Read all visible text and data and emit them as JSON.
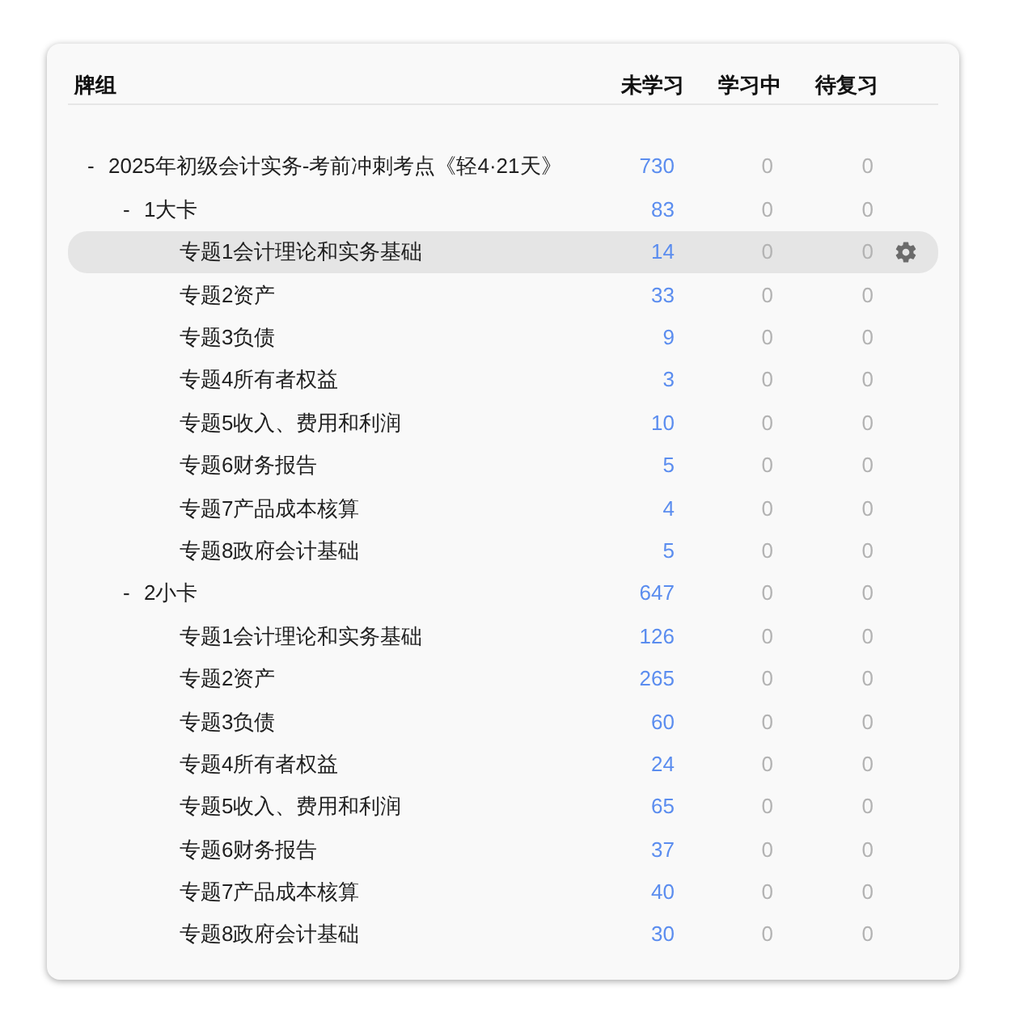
{
  "columns": [
    "牌组",
    "未学习",
    "学习中",
    "待复习"
  ],
  "decks": [
    {
      "toggle": "-",
      "name": "2025年初级会计实务-考前冲刺考点《轻4·21天》",
      "new": "730",
      "learn": "0",
      "review": "0",
      "selected": false,
      "children": [
        {
          "toggle": "-",
          "name": "1大卡",
          "new": "83",
          "learn": "0",
          "review": "0",
          "selected": false,
          "children": [
            {
              "name": "专题1会计理论和实务基础",
              "new": "14",
              "learn": "0",
              "review": "0",
              "selected": true
            },
            {
              "name": "专题2资产",
              "new": "33",
              "learn": "0",
              "review": "0",
              "selected": false
            },
            {
              "name": "专题3负债",
              "new": "9",
              "learn": "0",
              "review": "0",
              "selected": false
            },
            {
              "name": "专题4所有者权益",
              "new": "3",
              "learn": "0",
              "review": "0",
              "selected": false
            },
            {
              "name": "专题5收入、费用和利润",
              "new": "10",
              "learn": "0",
              "review": "0",
              "selected": false
            },
            {
              "name": "专题6财务报告",
              "new": "5",
              "learn": "0",
              "review": "0",
              "selected": false
            },
            {
              "name": "专题7产品成本核算",
              "new": "4",
              "learn": "0",
              "review": "0",
              "selected": false
            },
            {
              "name": "专题8政府会计基础",
              "new": "5",
              "learn": "0",
              "review": "0",
              "selected": false
            }
          ]
        },
        {
          "toggle": "-",
          "name": "2小卡",
          "new": "647",
          "learn": "0",
          "review": "0",
          "selected": false,
          "children": [
            {
              "name": "专题1会计理论和实务基础",
              "new": "126",
              "learn": "0",
              "review": "0",
              "selected": false
            },
            {
              "name": "专题2资产",
              "new": "265",
              "learn": "0",
              "review": "0",
              "selected": false
            },
            {
              "name": "专题3负债",
              "new": "60",
              "learn": "0",
              "review": "0",
              "selected": false
            },
            {
              "name": "专题4所有者权益",
              "new": "24",
              "learn": "0",
              "review": "0",
              "selected": false
            },
            {
              "name": "专题5收入、费用和利润",
              "new": "65",
              "learn": "0",
              "review": "0",
              "selected": false
            },
            {
              "name": "专题6财务报告",
              "new": "37",
              "learn": "0",
              "review": "0",
              "selected": false
            },
            {
              "name": "专题7产品成本核算",
              "new": "40",
              "learn": "0",
              "review": "0",
              "selected": false
            },
            {
              "name": "专题8政府会计基础",
              "new": "30",
              "learn": "0",
              "review": "0",
              "selected": false
            }
          ]
        }
      ]
    }
  ]
}
